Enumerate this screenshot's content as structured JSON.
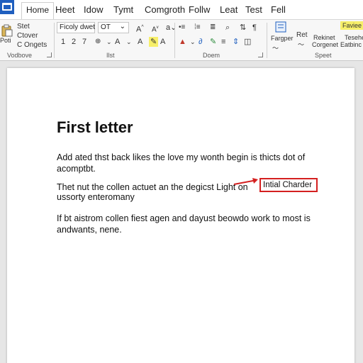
{
  "tabs": [
    "Home",
    "Heet",
    "Idow",
    "Tymt",
    "Comgroth",
    "Follw",
    "Leat",
    "Test",
    "Fell"
  ],
  "ribbon": {
    "clipboard": {
      "paste_label": "Poti",
      "items": [
        "Stet",
        "Ctover",
        "C Ongets"
      ],
      "group_label": "Vodbove"
    },
    "font": {
      "font_name": "Ficoly dwet",
      "font_size": "OT",
      "sizes_row": [
        "1",
        "2",
        "7"
      ],
      "group_label": "Ilst"
    },
    "paragraph": {
      "group_label": "Doem"
    },
    "styles": {
      "big_label": "Fargper",
      "item1": "Ret",
      "item2": "Rekinet",
      "item2_sub": "Corgenet",
      "item3": "Tesehe",
      "item3_sub": "Eatbinc",
      "highlight_style": "Faviee",
      "group_label": "Speet"
    },
    "colors": {
      "accent": "#1f5fbf",
      "highlight_yellow": "#f7ef6a",
      "font_red": "#d42020"
    }
  },
  "document": {
    "title": "First letter",
    "para1": "Add ated thst back likes the love my wonth begin is thicts dot of acomptbt.",
    "para2_line1": "Thet nut the collen actuet an the degicst Light on",
    "para2_line2": "ussorty enteromany",
    "callout": "Intial Charder",
    "para3": "If bt aistrom collen fiest agen and dayust beowdo work to most is andwants, nene."
  }
}
